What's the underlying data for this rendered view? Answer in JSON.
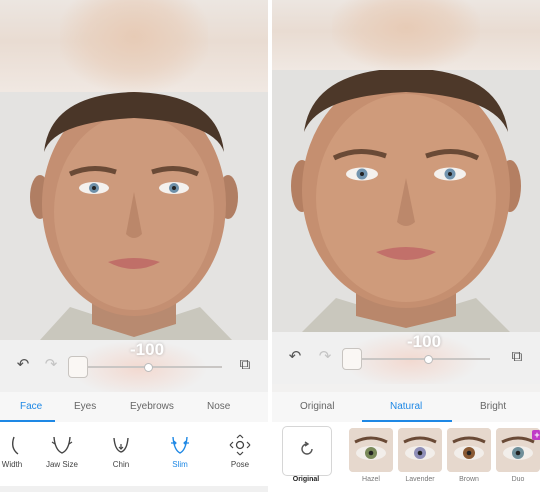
{
  "left_panel": {
    "slider_value": "-100",
    "tabs": [
      "Face",
      "Eyes",
      "Eyebrows",
      "Nose"
    ],
    "active_tab": "Face",
    "tools": [
      {
        "label": "Width",
        "icon": "face-width-icon"
      },
      {
        "label": "Jaw Size",
        "icon": "jaw-size-icon"
      },
      {
        "label": "Chin",
        "icon": "chin-icon"
      },
      {
        "label": "Slim",
        "icon": "slim-face-icon"
      },
      {
        "label": "Pose",
        "icon": "pose-icon"
      }
    ],
    "active_tool": "Slim"
  },
  "right_panel": {
    "slider_value": "-100",
    "tabs": [
      "Original",
      "Natural",
      "Bright"
    ],
    "active_tab": "Natural",
    "original_label": "Original",
    "eye_colors": [
      {
        "label": "Hazel",
        "color": "#7a8a5a"
      },
      {
        "label": "Lavender",
        "color": "#8f8fb8"
      },
      {
        "label": "Brown",
        "color": "#8a5a34"
      },
      {
        "label": "Duo",
        "color": "#6f8f9a"
      }
    ]
  },
  "colors": {
    "accent": "#1e88e5",
    "premium_badge": "#c03cc7"
  }
}
